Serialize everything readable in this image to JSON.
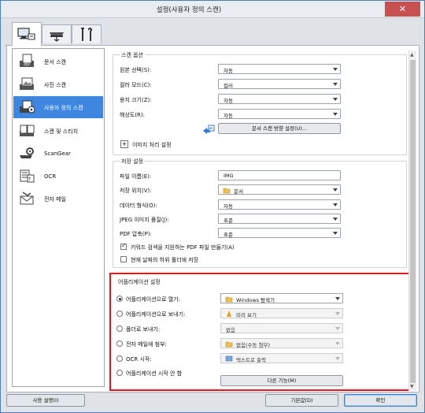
{
  "window": {
    "title": "설정(사용자 정의 스캔)",
    "close_glyph": "✕"
  },
  "tabs": [
    {
      "name": "scan-from-computer",
      "icon": "computer-scan-icon"
    },
    {
      "name": "scan-from-operation-panel",
      "icon": "scanner-icon"
    },
    {
      "name": "general-settings",
      "icon": "tools-icon"
    }
  ],
  "sidebar": {
    "items": [
      {
        "label": "문서 스캔",
        "icon": "document-icon"
      },
      {
        "label": "사진 스캔",
        "icon": "photo-icon"
      },
      {
        "label": "사용자 정의 스캔",
        "icon": "custom-scan-icon",
        "active": true
      },
      {
        "label": "스캔 및 스티치",
        "icon": "stitch-icon"
      },
      {
        "label": "ScanGear",
        "icon": "scangear-icon"
      },
      {
        "label": "OCR",
        "icon": "ocr-icon"
      },
      {
        "label": "전자 메일",
        "icon": "email-icon"
      }
    ]
  },
  "scan_options": {
    "title": "스캔 옵션",
    "source": {
      "label": "원본 선택(S):",
      "value": "자동"
    },
    "color_mode": {
      "label": "컬러 모드(C):",
      "value": "컬러"
    },
    "paper_size": {
      "label": "용지 크기(Z):",
      "value": "자동"
    },
    "resolution": {
      "label": "해상도(R):",
      "value": "자동"
    },
    "orientation_button": "문서 스캔 방향 설정(U)...",
    "image_processing": {
      "expander": "+",
      "label": "이미지 처리 설정"
    }
  },
  "save_settings": {
    "title": "저장 설정",
    "file_name": {
      "label": "파일 이름(E):",
      "value": "IMG"
    },
    "save_in": {
      "label": "저장 위치(V):",
      "value": "문서"
    },
    "data_format": {
      "label": "데이터 형식(O):",
      "value": "자동"
    },
    "jpeg_quality": {
      "label": "JPEG 이미지 품질(J):",
      "value": "표준"
    },
    "pdf_compression": {
      "label": "PDF 압축(P):",
      "value": "표준"
    },
    "searchable_pdf": {
      "label": "키워드 검색을 지원하는 PDF 파일 만들기(A)",
      "checked": true
    },
    "date_subfolder": {
      "label": "현재 날짜의 하위 폴더에 저장",
      "checked": false
    }
  },
  "app_settings": {
    "title": "어플리케이션 설정",
    "open_with": {
      "label": "어플리케이션으로 열기:",
      "value": "Windows 탐색기",
      "selected": true
    },
    "send_to_app": {
      "label": "어플리케이션으로 보내기:",
      "value": "미리 보기"
    },
    "send_to_folder": {
      "label": "폴더로 보내기:",
      "value": "없음"
    },
    "attach_email": {
      "label": "전자 메일에 첨부:",
      "value": "없음(수동 첨부)"
    },
    "start_ocr": {
      "label": "OCR 시작:",
      "value": "텍스트로 출력"
    },
    "no_app": {
      "label": "어플리케이션 시작 안 함"
    },
    "more_functions": "다른 기능(M)"
  },
  "footer": {
    "instructions": "사용 설명(I)",
    "defaults": "기본값(D)",
    "ok": "확인"
  },
  "colors": {
    "accent": "#3e86e0",
    "highlight": "#e3161d"
  }
}
